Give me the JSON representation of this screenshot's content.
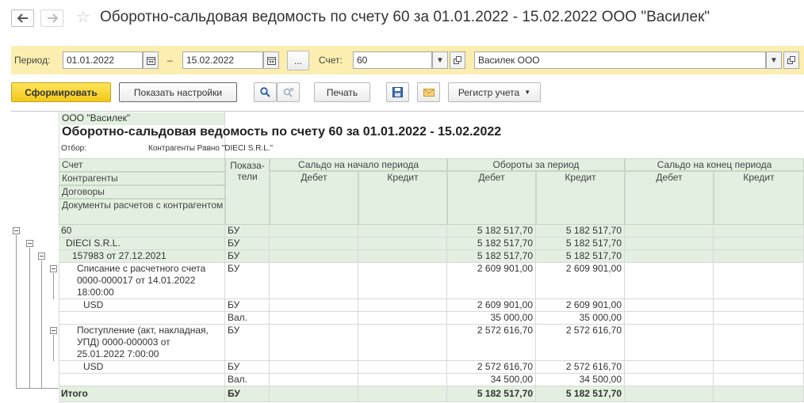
{
  "window": {
    "title": "Оборотно-сальдовая ведомость по счету 60 за 01.01.2022 - 15.02.2022 ООО \"Василек\""
  },
  "filters": {
    "period_label": "Период:",
    "date_from": "01.01.2022",
    "dash": "–",
    "date_to": "15.02.2022",
    "more_label": "...",
    "account_label": "Счет:",
    "account": "60",
    "organization": "Василек ООО"
  },
  "toolbar": {
    "generate": "Сформировать",
    "show_settings": "Показать настройки",
    "print": "Печать",
    "register": "Регистр учета"
  },
  "report": {
    "org": "ООО \"Василек\"",
    "title": "Оборотно-сальдовая ведомость по счету 60 за 01.01.2022 - 15.02.2022",
    "selection_label": "Отбор:",
    "selection_value": "Контрагенты Равно \"DIECI S.R.L.\"",
    "headers": {
      "account": "Счет",
      "counterparties": "Контрагенты",
      "contracts": "Договоры",
      "documents": "Документы расчетов с контрагентом",
      "indicators": "Показа-\nтели",
      "opening": "Сальдо на начало периода",
      "turnover": "Обороты за период",
      "closing": "Сальдо на конец периода",
      "debit": "Дебет",
      "credit": "Кредит"
    },
    "rows": [
      {
        "name": "60",
        "ind": "БУ",
        "d": "5 182 517,70",
        "c": "5 182 517,70"
      },
      {
        "name": "DIECI S.R.L.",
        "ind": "БУ",
        "d": "5 182 517,70",
        "c": "5 182 517,70"
      },
      {
        "name": "157983 от 27.12.2021",
        "ind": "БУ",
        "d": "5 182 517,70",
        "c": "5 182 517,70"
      },
      {
        "name": "Списание с расчетного счета 0000-000017 от 14.01.2022 18:00:00",
        "ind": "БУ",
        "d": "2 609 901,00",
        "c": "2 609 901,00"
      },
      {
        "name": "USD",
        "ind": "БУ",
        "d": "2 609 901,00",
        "c": "2 609 901,00"
      },
      {
        "name": "",
        "ind": "Вал.",
        "d": "35 000,00",
        "c": "35 000,00"
      },
      {
        "name": "Поступление (акт, накладная, УПД) 0000-000003 от 25.01.2022 7:00:00",
        "ind": "БУ",
        "d": "2 572 616,70",
        "c": "2 572 616,70"
      },
      {
        "name": "USD",
        "ind": "БУ",
        "d": "2 572 616,70",
        "c": "2 572 616,70"
      },
      {
        "name": "",
        "ind": "Вал.",
        "d": "34 500,00",
        "c": "34 500,00"
      }
    ],
    "total": {
      "name": "Итого",
      "ind": "БУ",
      "d": "5 182 517,70",
      "c": "5 182 517,70"
    }
  }
}
